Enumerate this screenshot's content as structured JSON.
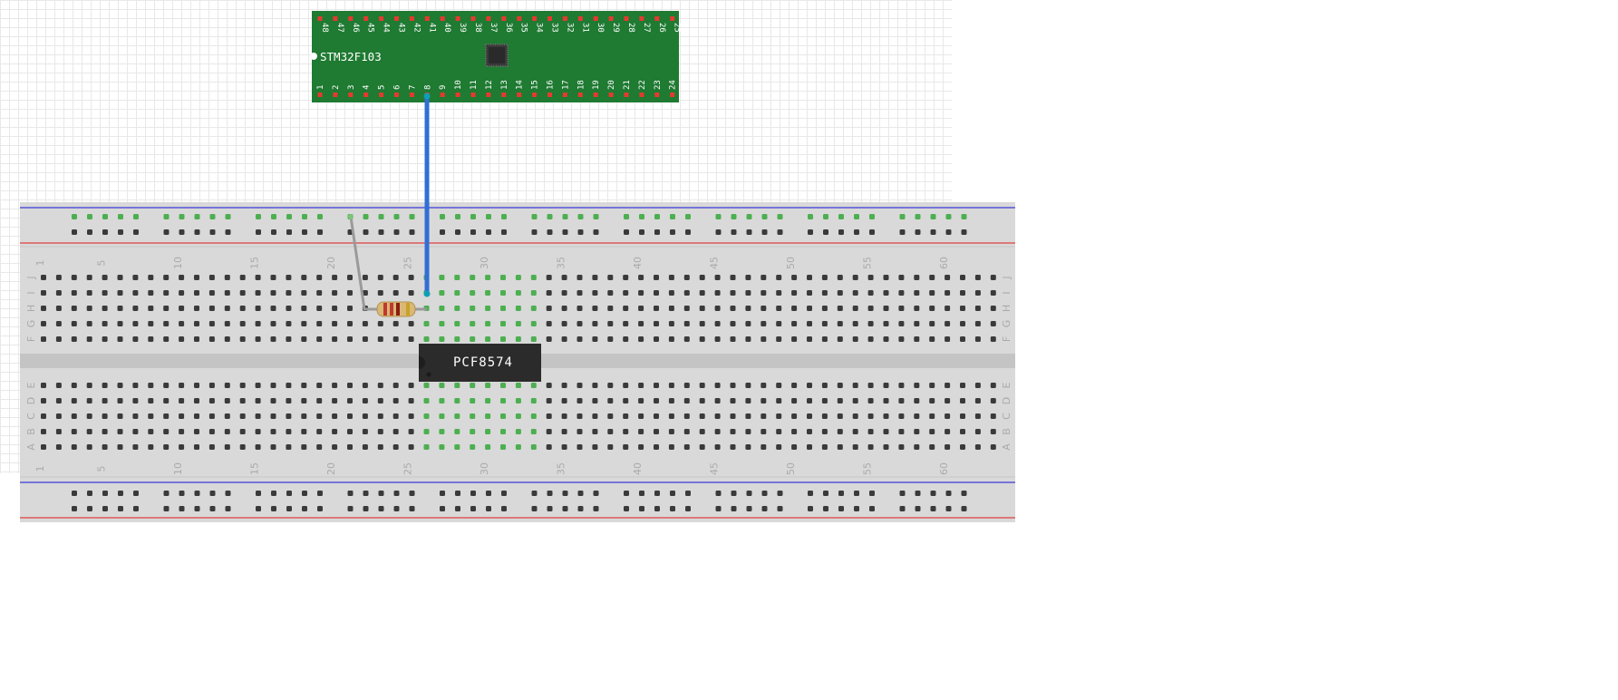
{
  "mcu": {
    "name": "STM32F103",
    "top_pins": [
      "48",
      "47",
      "46",
      "45",
      "44",
      "43",
      "42",
      "41",
      "40",
      "39",
      "38",
      "37",
      "36",
      "35",
      "34",
      "33",
      "32",
      "31",
      "30",
      "29",
      "28",
      "27",
      "26",
      "25"
    ],
    "bottom_pins": [
      "1",
      "2",
      "3",
      "4",
      "5",
      "6",
      "7",
      "8",
      "9",
      "10",
      "11",
      "12",
      "13",
      "14",
      "15",
      "16",
      "17",
      "18",
      "19",
      "20",
      "21",
      "22",
      "23",
      "24"
    ],
    "board_color": "#1f7a32",
    "pin_color": "#e53a2f"
  },
  "breadboard": {
    "columns": 63,
    "column_labels": [
      "1",
      "5",
      "10",
      "15",
      "20",
      "25",
      "30",
      "35",
      "40",
      "45",
      "50",
      "55",
      "60"
    ],
    "upper_rows": [
      "J",
      "I",
      "H",
      "G",
      "F"
    ],
    "lower_rows": [
      "E",
      "D",
      "C",
      "B",
      "A"
    ],
    "rail_blue": "#3a3ad6",
    "rail_red": "#e04040",
    "highlight_color": "#4caf50"
  },
  "ic": {
    "label": "PCF8574",
    "body_color": "#2b2b2b"
  },
  "resistor": {
    "bands": [
      "#c0392b",
      "#c0392b",
      "#8a1d10",
      "#c9a227"
    ]
  },
  "wires": {
    "signal_color": "#2f6fd6",
    "lead_color": "#9a9a9a"
  }
}
